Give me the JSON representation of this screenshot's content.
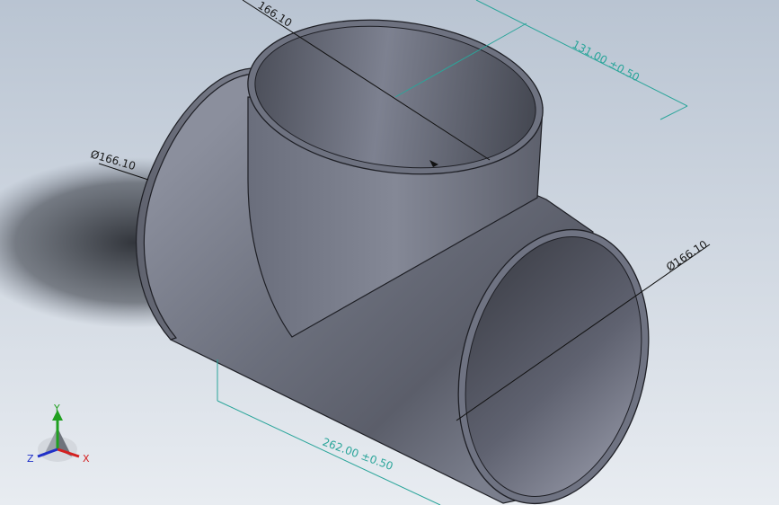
{
  "viewport": {
    "background_top": "#bcc6d3",
    "background_bottom": "#e6ebf0"
  },
  "dimensions": {
    "top_diameter": "166.10",
    "left_diameter": "Ø166.10",
    "right_diameter": "Ø166.10",
    "height": "131.00 ±0.50",
    "length": "262.00 ±0.50"
  },
  "triad": {
    "x_label": "X",
    "y_label": "Y",
    "z_label": "Z",
    "x_color": "#d42020",
    "y_color": "#20a020",
    "z_color": "#2030c8"
  },
  "colors": {
    "part": "#7a7f8e",
    "part_edge": "#1e1f25",
    "dimension_teal": "#2aa59a"
  }
}
